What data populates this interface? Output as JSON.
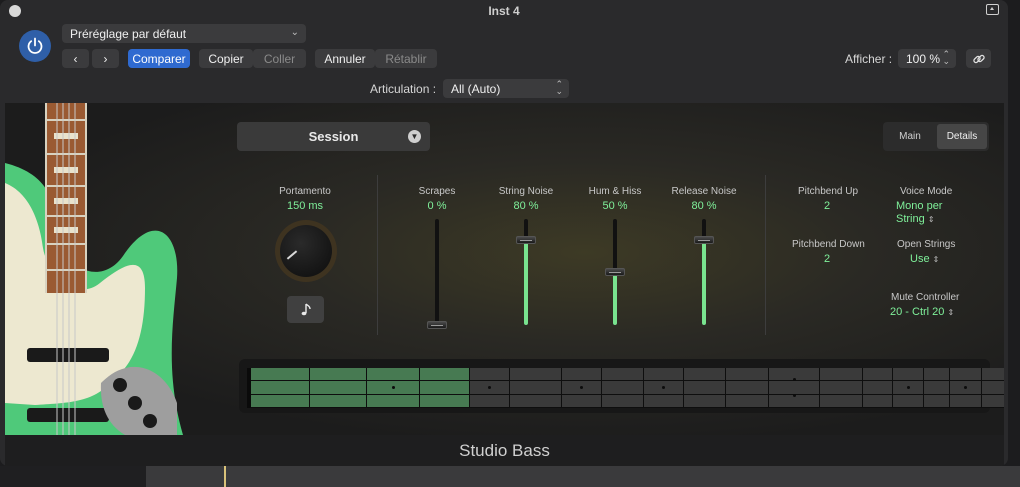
{
  "window": {
    "title": "Inst 4"
  },
  "toolbar": {
    "preset": "Préréglage par défaut",
    "compare": "Comparer",
    "copy": "Copier",
    "paste": "Coller",
    "undo": "Annuler",
    "redo": "Rétablir",
    "view_label": "Afficher :",
    "view_value": "100 %",
    "articulation_label": "Articulation :",
    "articulation_value": "All (Auto)"
  },
  "plugin": {
    "style": "Session",
    "tabs": [
      {
        "label": "Main"
      },
      {
        "label": "Details",
        "active": true
      }
    ],
    "portamento": {
      "label": "Portamento",
      "value": "150 ms"
    },
    "sliders": [
      {
        "label": "Scrapes",
        "value": "0 %",
        "level": 0
      },
      {
        "label": "String Noise",
        "value": "80 %",
        "level": 80
      },
      {
        "label": "Hum & Hiss",
        "value": "50 %",
        "level": 50
      },
      {
        "label": "Release Noise",
        "value": "80 %",
        "level": 80
      }
    ],
    "pitchbend_up": {
      "label": "Pitchbend Up",
      "value": "2"
    },
    "pitchbend_down": {
      "label": "Pitchbend Down",
      "value": "2"
    },
    "voice_mode": {
      "label": "Voice Mode",
      "value": "Mono per String"
    },
    "open_strings": {
      "label": "Open Strings",
      "value": "Use"
    },
    "mute_controller": {
      "label": "Mute Controller",
      "value": "20 - Ctrl 20"
    },
    "instrument_name": "Studio Bass"
  },
  "fretboard": {
    "frets": 19,
    "active_frets": 4,
    "single_markers": [
      3,
      5,
      7,
      9,
      12,
      15,
      17,
      19
    ],
    "double_markers": [
      12
    ]
  },
  "colors": {
    "accent_green": "#7ff09a",
    "accent_blue": "#2f6ad0",
    "power_blue": "#2f5fa8"
  }
}
